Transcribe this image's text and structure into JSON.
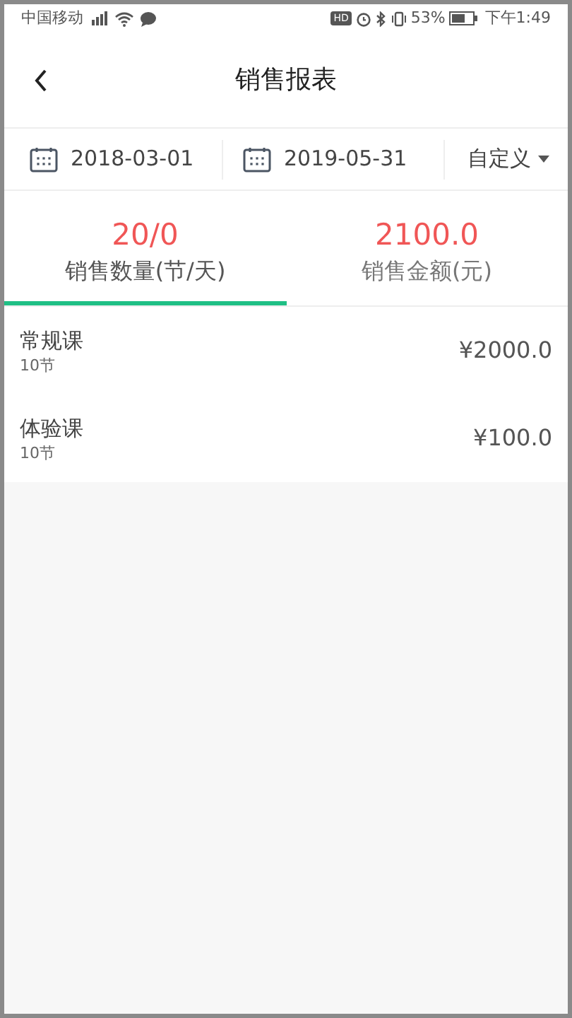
{
  "status_bar": {
    "carrier": "中国移动",
    "hd": "HD",
    "battery_text": "53%",
    "time": "下午1:49"
  },
  "header": {
    "title": "销售报表"
  },
  "date_filter": {
    "start": "2018-03-01",
    "end": "2019-05-31",
    "range": "自定义"
  },
  "tabs": [
    {
      "value": "20/0",
      "label": "销售数量(节/天)",
      "selected": true
    },
    {
      "value": "2100.0",
      "label": "销售金额(元)",
      "selected": false
    }
  ],
  "rows": [
    {
      "name": "常规课",
      "count": "10节",
      "amount": "¥2000.0"
    },
    {
      "name": "体验课",
      "count": "10节",
      "amount": "¥100.0"
    }
  ]
}
